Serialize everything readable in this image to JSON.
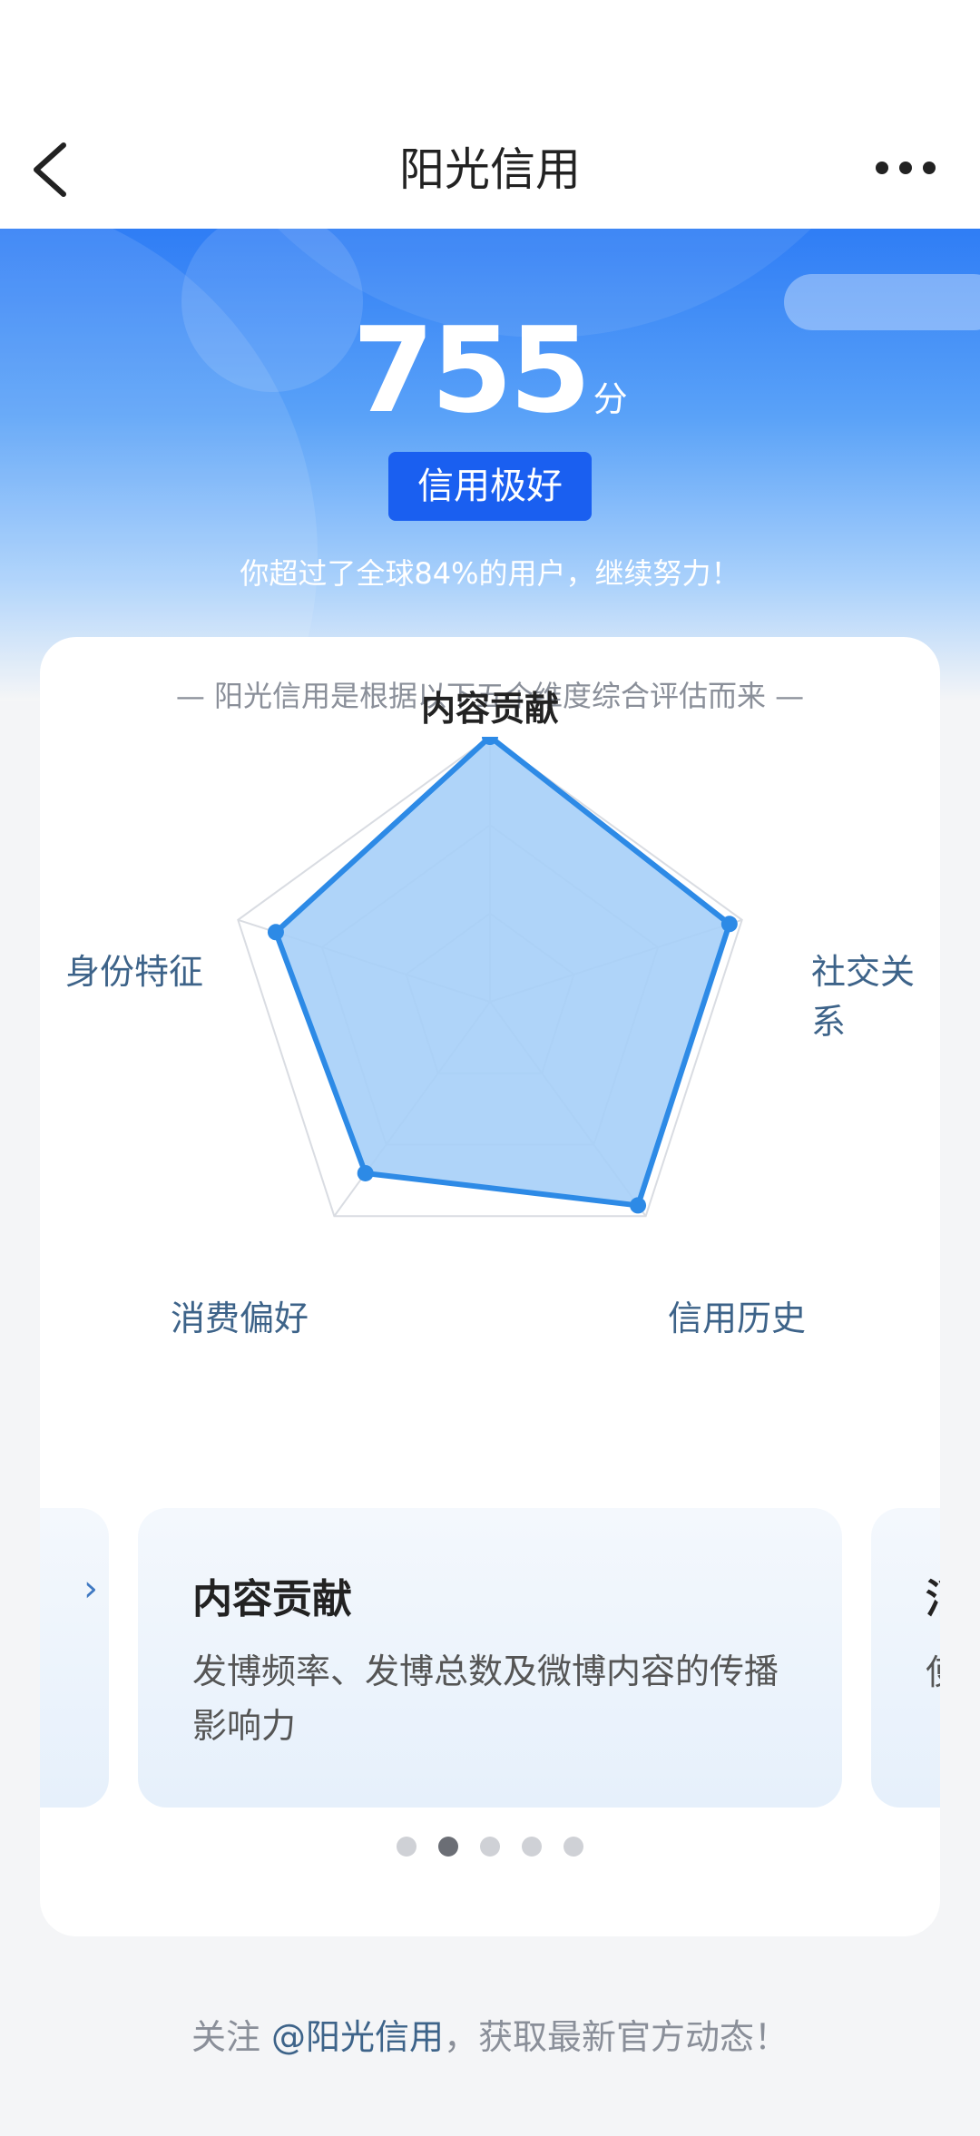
{
  "header": {
    "title": "阳光信用"
  },
  "score": {
    "value": "755",
    "unit": "分",
    "level": "信用极好",
    "beat_text": "你超过了全球84%的用户，继续努力！"
  },
  "card": {
    "subtitle": "— 阳光信用是根据以下五个维度综合评估而来 —",
    "dimensions": [
      {
        "label": "内容贡献",
        "value": 1.0
      },
      {
        "label": "社交关系",
        "value": 0.95
      },
      {
        "label": "信用历史",
        "value": 0.95
      },
      {
        "label": "消费偏好",
        "value": 0.8
      },
      {
        "label": "身份特征",
        "value": 0.85
      }
    ],
    "carousel": {
      "active_index": 1,
      "current": {
        "title": "内容贡献",
        "description": "发博频率、发博总数及微博内容的传播影响力"
      },
      "next_peek_title": "消",
      "next_peek_desc": "使"
    }
  },
  "colors": {
    "accent": "#2d8ae6",
    "fill": "#a6cff8"
  },
  "footer": {
    "prefix": "关注 ",
    "handle": "@阳光信用",
    "suffix": "，获取最新官方动态！"
  }
}
